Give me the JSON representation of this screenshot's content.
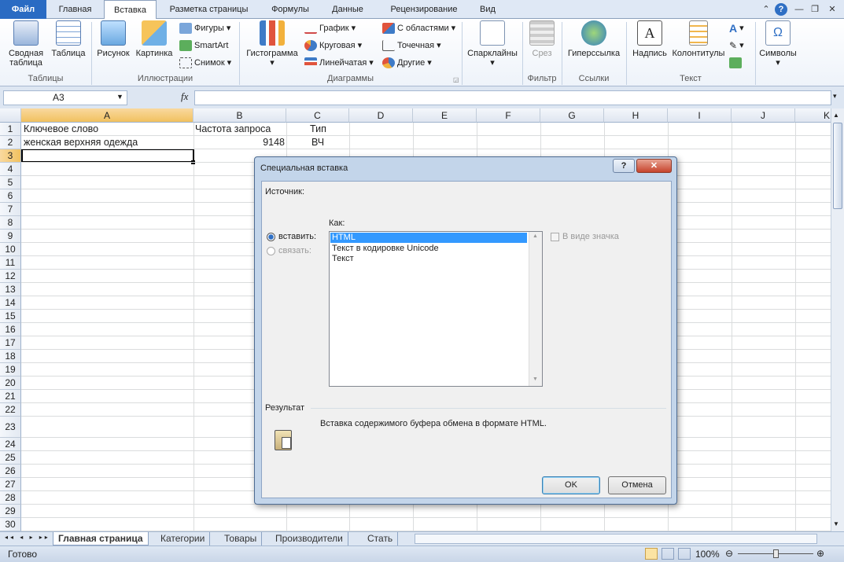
{
  "ribbon_tabs": [
    "Файл",
    "Главная",
    "Вставка",
    "Разметка страницы",
    "Формулы",
    "Данные",
    "Рецензирование",
    "Вид"
  ],
  "active_tab": "Вставка",
  "groups": {
    "tables": {
      "label": "Таблицы",
      "pivot": "Сводная\nтаблица",
      "table": "Таблица"
    },
    "illustrations": {
      "label": "Иллюстрации",
      "picture": "Рисунок",
      "clipart": "Картинка",
      "shapes": "Фигуры",
      "smartart": "SmartArt",
      "screenshot": "Снимок"
    },
    "charts": {
      "label": "Диаграммы",
      "histogram": "Гистограмма",
      "line": "График",
      "pie": "Круговая",
      "bar": "Линейчатая",
      "area": "С областями",
      "scatter": "Точечная",
      "other": "Другие"
    },
    "sparklines": {
      "label": "",
      "name": "Спарклайны"
    },
    "filter": {
      "label": "Фильтр",
      "slicer": "Срез"
    },
    "links": {
      "label": "Ссылки",
      "hyperlink": "Гиперссылка"
    },
    "text": {
      "label": "Текст",
      "textbox": "Надпись",
      "header": "Колонтитулы"
    },
    "symbols": {
      "label": "",
      "name": "Символы"
    }
  },
  "formula_bar": {
    "name_box": "A3",
    "fx": "fx",
    "formula": ""
  },
  "columns": [
    "A",
    "B",
    "C",
    "D",
    "E",
    "F",
    "G",
    "H",
    "I",
    "J",
    "K"
  ],
  "rows": [
    "1",
    "2",
    "3",
    "4",
    "5",
    "6",
    "7",
    "8",
    "9",
    "10",
    "11",
    "12",
    "13",
    "14",
    "15",
    "16",
    "17",
    "18",
    "19",
    "20",
    "21",
    "22",
    "23",
    "24",
    "25",
    "26",
    "27",
    "28",
    "29",
    "30"
  ],
  "cells": {
    "A1": "Ключевое слово",
    "B1": "Частота запроса",
    "C1": "Тип",
    "A2": "женская верхняя одежда",
    "B2": "9148",
    "C2": "ВЧ"
  },
  "sheet_tabs": [
    "Главная страница",
    "Категории",
    "Товары",
    "Производители",
    "Стать"
  ],
  "status": {
    "ready": "Готово",
    "zoom": "100%"
  },
  "dialog": {
    "title": "Специальная вставка",
    "source_label": "Источник:",
    "as_label": "Как:",
    "paste_label": "вставить:",
    "link_label": "связать:",
    "formats": [
      "HTML",
      "Текст в кодировке Unicode",
      "Текст"
    ],
    "icon_label": "В виде значка",
    "result_label": "Результат",
    "result_text": "Вставка содержимого буфера обмена в формате HTML.",
    "ok": "OK",
    "cancel": "Отмена",
    "help": "?"
  }
}
